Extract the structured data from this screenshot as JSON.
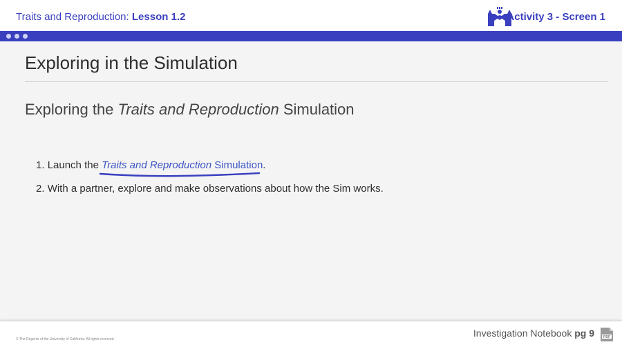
{
  "header": {
    "unit_title": "Traits and Reproduction:",
    "lesson": "Lesson 1.2",
    "activity": "Activity 3 - Screen 1",
    "logo_icon": "hands-up-logo-icon"
  },
  "nav_dots": [
    "dot",
    "dot",
    "dot"
  ],
  "page": {
    "title": "Exploring in the Simulation",
    "subtitle_prefix": "Exploring the ",
    "subtitle_italic": "Traits and Reproduction",
    "subtitle_suffix": " Simulation"
  },
  "steps": [
    {
      "number": "1.",
      "prefix": "Launch the ",
      "link_italic": "Traits and Reproduction",
      "link_text": " Simulation",
      "suffix": "."
    },
    {
      "number": "2.",
      "text": "With a partner, explore and make observations about how the Sim works."
    }
  ],
  "footer": {
    "copyright": "© The Regents of the University of California. All rights reserved.",
    "notebook_label": "Investigation Notebook",
    "page_ref": "pg 9",
    "pdf_icon": "pdf-icon"
  },
  "colors": {
    "brand_blue": "#3a3fbf",
    "link_blue": "#3d55c4",
    "background": "#f4f4f4"
  }
}
